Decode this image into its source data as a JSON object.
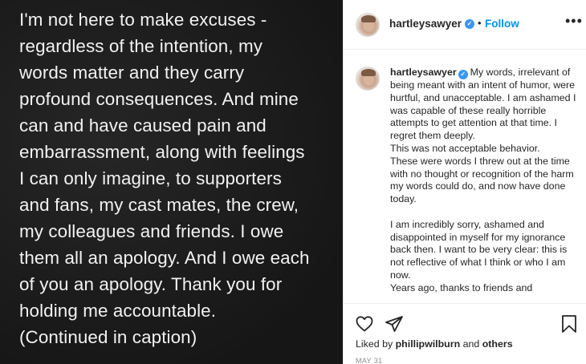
{
  "post": {
    "image_text_lines": [
      "I'm not here to make excuses -",
      "regardless of the intention, my",
      "words matter and they carry",
      "profound consequences. And mine",
      "can and have caused pain and",
      "embarrassment, along with feelings",
      "I can only imagine, to supporters",
      "and fans, my cast mates, the crew,",
      "my colleagues and friends. I owe",
      "them all an apology. And I owe each",
      "of you an apology. Thank you for",
      "holding me accountable.",
      "(Continued in caption)"
    ]
  },
  "header": {
    "username": "hartleysawyer",
    "verified_mark": "✓",
    "separator": "•",
    "follow_label": "Follow",
    "more_label": "•••"
  },
  "caption": {
    "username": "hartleysawyer",
    "paragraph_1": "My words, irrelevant of being meant with an intent of humor, were hurtful, and unacceptable. I am ashamed I was capable of these really horrible attempts to get attention at that time. I regret them deeply.",
    "paragraph_2": "This was not acceptable behavior.",
    "paragraph_3": "These were words I threw out at the time with no thought or recognition of the harm my words could do, and now have done today.",
    "paragraph_4": "I am incredibly sorry, ashamed and disappointed in myself for my ignorance back then. I want to be very clear: this is not reflective of what I think or who I am now.",
    "paragraph_5": "Years ago, thanks to friends and"
  },
  "actions": {
    "liked_by_prefix": "Liked by",
    "liked_by_user": "phillipwilburn",
    "and_label": "and",
    "others_label": "others",
    "date": "MAY 31"
  },
  "colors": {
    "follow_blue": "#0095f6",
    "verified_blue": "#3897f0",
    "post_background": "#1b1b1b"
  },
  "icons": [
    "avatar",
    "verified-badge",
    "more-icon",
    "heart-icon",
    "share-icon",
    "bookmark-icon"
  ]
}
